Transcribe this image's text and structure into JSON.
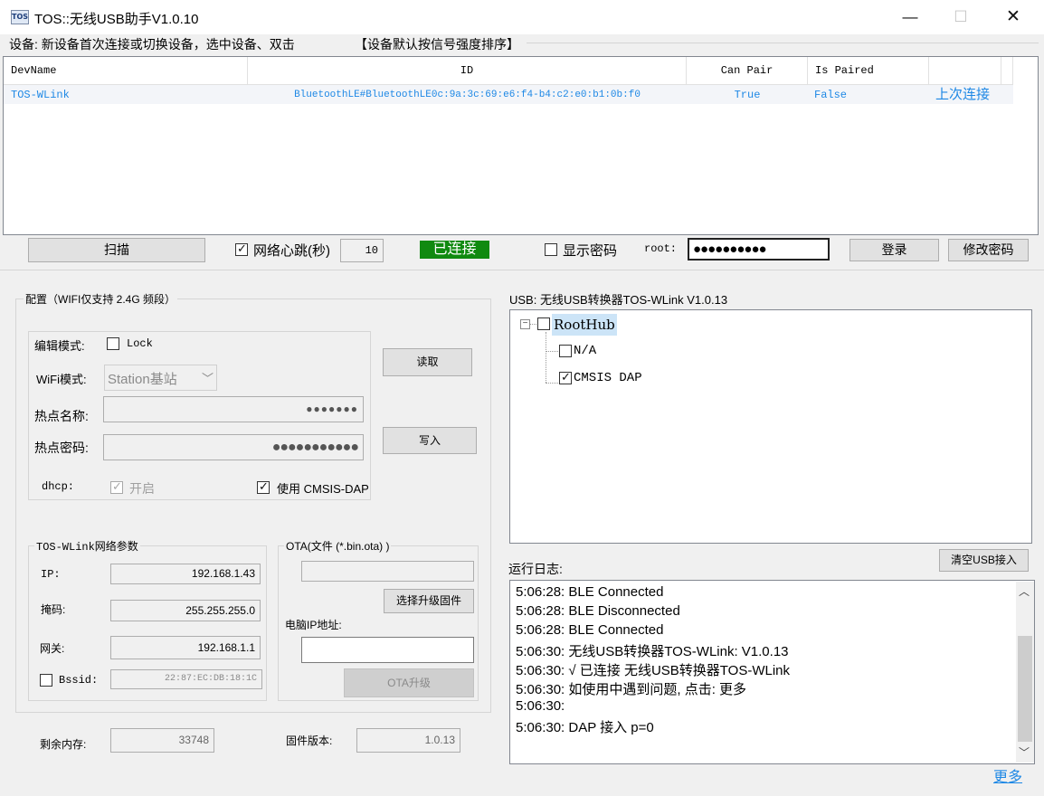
{
  "window": {
    "icon_text": "TOS",
    "title": "TOS::无线USB助手V1.0.10",
    "minimize": "—",
    "maximize": "☐",
    "close": "✕"
  },
  "device_hint": "设备: 新设备首次连接或切换设备，选中设备、双击",
  "sort_hint": "【设备默认按信号强度排序】",
  "table": {
    "headers": [
      "DevName",
      "ID",
      "Can Pair",
      "Is Paired",
      ""
    ],
    "rows": [
      {
        "devname": "TOS-WLink",
        "id": "BluetoothLE#BluetoothLE0c:9a:3c:69:e6:f4-b4:c2:e0:b1:0b:f0",
        "can_pair": "True",
        "is_paired": "False",
        "extra": "上次连接"
      }
    ]
  },
  "toolbar": {
    "scan": "扫描",
    "heartbeat_label": "网络心跳(秒)",
    "heartbeat_checked": true,
    "heartbeat_value": "10",
    "status": "已连接",
    "show_password": "显示密码",
    "root_label": "root:",
    "root_password": "●●●●●●●●●●",
    "login": "登录",
    "change_password": "修改密码"
  },
  "config": {
    "legend": "配置（WIFI仅支持 2.4G 频段）",
    "edit_mode_label": "编辑模式:",
    "lock": "Lock",
    "wifi_mode_label": "WiFi模式:",
    "wifi_mode_value": "Station基站",
    "ssid_label": "热点名称:",
    "ssid_value": "●●●●●●●",
    "wifi_pass_label": "热点密码:",
    "wifi_pass_value": "●●●●●●●●●●●",
    "dhcp_label": "dhcp:",
    "dhcp_option": "开启",
    "use_cmsis": "使用 CMSIS-DAP",
    "read": "读取",
    "write": "写入"
  },
  "network": {
    "legend": "TOS-WLink网络参数",
    "ip_label": "IP:",
    "ip": "192.168.1.43",
    "mask_label": "掩码:",
    "mask": "255.255.255.0",
    "gateway_label": "网关:",
    "gateway": "192.168.1.1",
    "bssid_label": "Bssid:",
    "bssid": "22:87:EC:DB:18:1C"
  },
  "ota": {
    "legend": "OTA(文件 (*.bin.ota) )",
    "file_path": "",
    "select_firmware": "选择升级固件",
    "pc_ip_label": "电脑IP地址:",
    "pc_ip": "",
    "upgrade": "OTA升级"
  },
  "footer": {
    "free_mem_label": "剩余内存:",
    "free_mem": "33748",
    "fw_version_label": "固件版本:",
    "fw_version": "1.0.13"
  },
  "usb": {
    "title": "USB: 无线USB转换器TOS-WLink V1.0.13",
    "root": "RootHub",
    "children": [
      {
        "label": "N/A",
        "checked": false
      },
      {
        "label": "CMSIS DAP",
        "checked": true
      }
    ],
    "clear": "清空USB接入"
  },
  "log": {
    "label": "运行日志:",
    "lines": [
      "5:06:28: BLE Connected",
      "5:06:28: BLE Disconnected",
      "5:06:28: BLE Connected",
      "5:06:30: 无线USB转换器TOS-WLink: V1.0.13",
      "5:06:30:    √ 已连接 无线USB转换器TOS-WLink",
      "5:06:30: 如使用中遇到问题, 点击: 更多",
      "5:06:30:",
      "5:06:30: DAP 接入 p=0"
    ],
    "more": "更多"
  },
  "colors": {
    "link": "#1e88e5",
    "connected_bg": "#108a10",
    "tree_selected": "#cce4f7"
  }
}
